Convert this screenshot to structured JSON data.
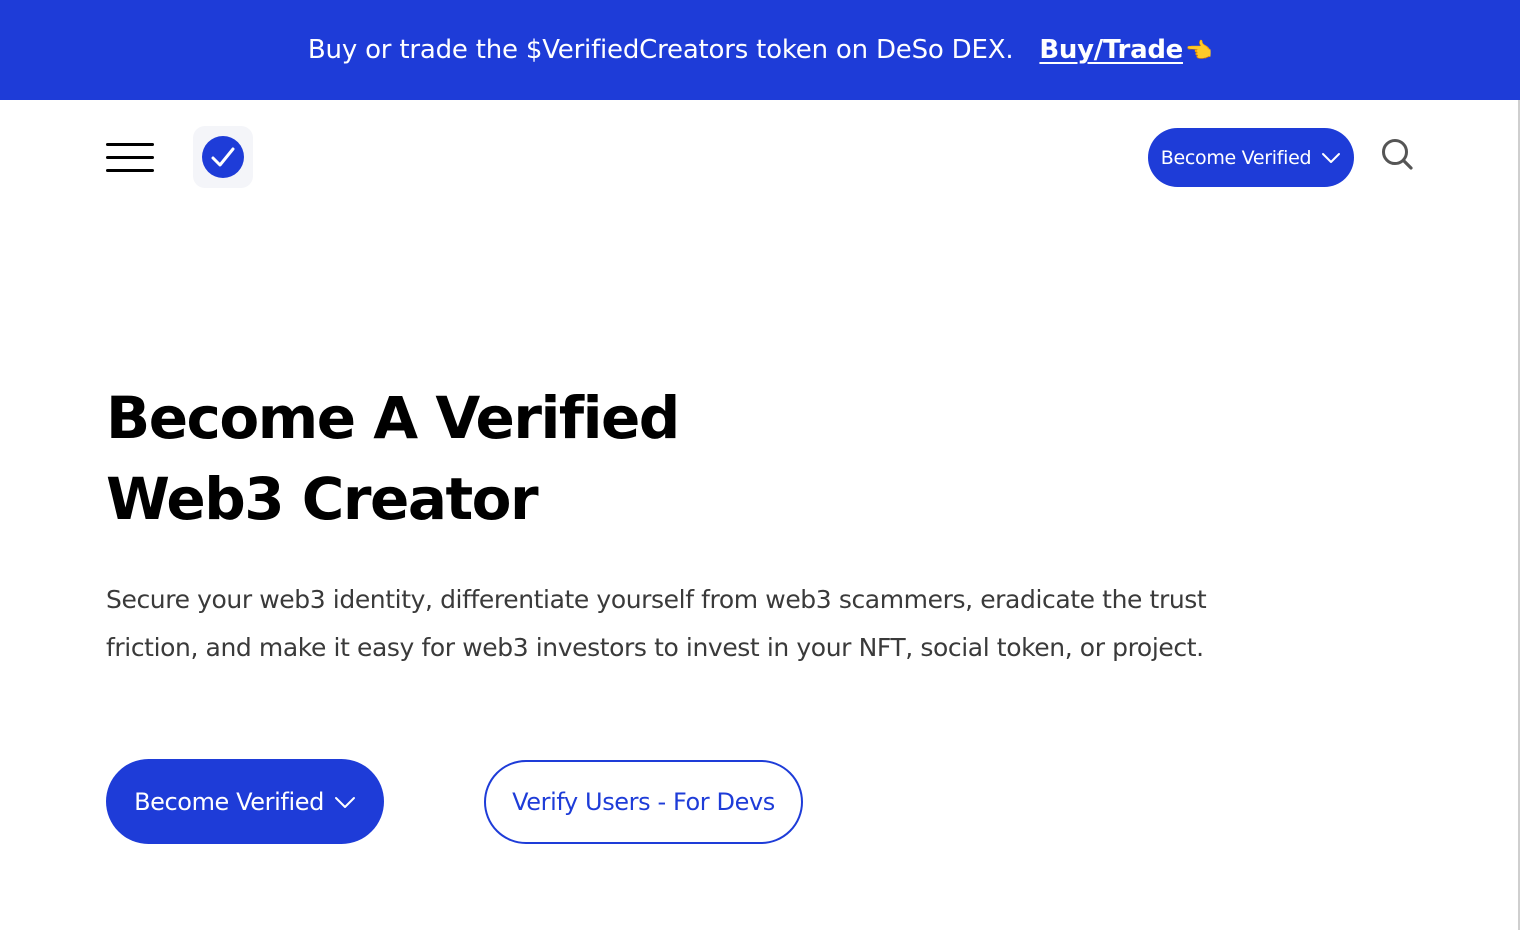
{
  "banner": {
    "text": "Buy or trade the $VerifiedCreators token on DeSo DEX.",
    "link_label": "Buy/Trade",
    "link_icon": "👈"
  },
  "header": {
    "menu_icon": "hamburger-menu-icon",
    "logo_icon": "verified-check-icon",
    "cta_label": "Become Verified",
    "cta_icon": "chevron-down-icon",
    "search_icon": "search-icon"
  },
  "hero": {
    "title_line1": "Become A Verified",
    "title_line2": "Web3 Creator",
    "description": "Secure your web3 identity, differentiate yourself from web3 scammers, eradicate the trust friction, and make it easy for web3 investors to invest in your NFT, social token, or project.",
    "primary_cta": "Become Verified",
    "secondary_cta": "Verify Users - For Devs"
  },
  "colors": {
    "brand_blue": "#1e3cd8",
    "text": "#000000",
    "muted_text": "#3a3a3a",
    "background": "#ffffff"
  }
}
